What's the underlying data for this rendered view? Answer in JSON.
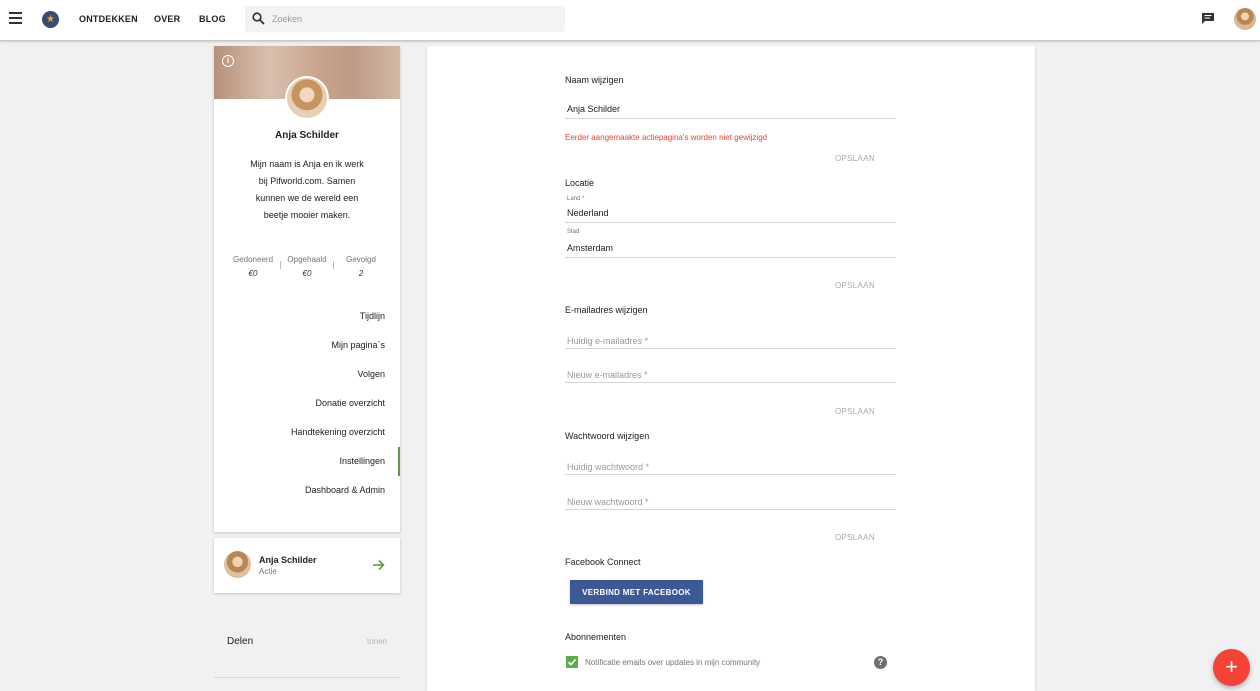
{
  "header": {
    "nav": [
      "ONTDEKKEN",
      "OVER",
      "BLOG"
    ],
    "search_placeholder": "Zoeken"
  },
  "profile": {
    "name": "Anja Schilder",
    "bio": "Mijn naam is Anja en ik werk bij Pifworld.com. Samen kunnen we de wereld een beetje mooier maken.",
    "stats": [
      {
        "label": "Gedoneerd",
        "value": "€0"
      },
      {
        "label": "Opgehaald",
        "value": "€0"
      },
      {
        "label": "Gevolgd",
        "value": "2"
      }
    ],
    "menu": [
      {
        "label": "Tijdlijn",
        "active": false
      },
      {
        "label": "Mijn pagina`s",
        "active": false
      },
      {
        "label": "Volgen",
        "active": false
      },
      {
        "label": "Donatie overzicht",
        "active": false
      },
      {
        "label": "Handtekening overzicht",
        "active": false
      },
      {
        "label": "Instellingen",
        "active": true
      },
      {
        "label": "Dashboard & Admin",
        "active": false
      }
    ]
  },
  "user_card": {
    "name": "Anja Schilder",
    "subtitle": "Actie"
  },
  "share": {
    "label": "Delen",
    "toggle": "tonen"
  },
  "settings": {
    "name_section": {
      "title": "Naam wijzigen",
      "value": "Anja Schilder",
      "warning": "Eerder aangemaakte actiepagina's worden niet gewijzigd",
      "save": "OPSLAAN"
    },
    "location_section": {
      "title": "Locatie",
      "country_label": "Land *",
      "country_value": "Nederland",
      "city_label": "Stad",
      "city_value": "Amsterdam",
      "save": "OPSLAAN"
    },
    "email_section": {
      "title": "E-mailadres wijzigen",
      "current_placeholder": "Huidig e-mailadres *",
      "new_placeholder": "Nieuw e-mailadres *",
      "save": "OPSLAAN"
    },
    "password_section": {
      "title": "Wachtwoord wijzigen",
      "current_placeholder": "Huidig wachtwoord *",
      "new_placeholder": "Nieuw wachtwoord *",
      "save": "OPSLAAN"
    },
    "facebook_section": {
      "title": "Facebook Connect",
      "button": "VERBIND MET FACEBOOK"
    },
    "subscriptions_section": {
      "title": "Abonnementen",
      "checkbox_label": "Notificatie emails over updates in mijn community",
      "checked": true
    }
  },
  "fab": {
    "label": "+"
  },
  "colors": {
    "accent_green": "#5c9c46",
    "facebook_blue": "#3c5895",
    "warning_red": "#e4472e",
    "fab_red": "#f44336"
  },
  "icons": [
    "menu-icon",
    "logo-icon",
    "search-icon",
    "chat-icon",
    "info-icon",
    "arrow-right-icon",
    "check-icon",
    "help-icon",
    "plus-icon"
  ]
}
